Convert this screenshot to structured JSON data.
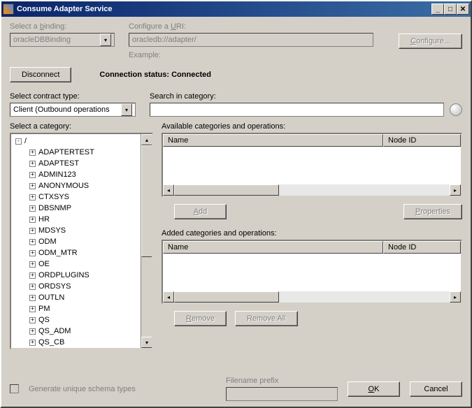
{
  "titlebar": {
    "title": "Consume Adapter Service"
  },
  "section1": {
    "binding_label": "Select a binding:",
    "binding_value": "oracleDBBinding",
    "uri_label": "Configure a URI:",
    "uri_value": "oracledb://adapter/",
    "example_label": "Example:",
    "configure_btn": "Configure..."
  },
  "status": {
    "disconnect_btn": "Disconnect",
    "status_label": "Connection status:",
    "status_value": "Connected"
  },
  "contract": {
    "label": "Select contract type:",
    "value": "Client (Outbound operations",
    "search_label": "Search in category:",
    "search_value": ""
  },
  "tree": {
    "label": "Select a category:",
    "root": "/",
    "items": [
      "ADAPTERTEST",
      "ADAPTEST",
      "ADMIN123",
      "ANONYMOUS",
      "CTXSYS",
      "DBSNMP",
      "HR",
      "MDSYS",
      "ODM",
      "ODM_MTR",
      "OE",
      "ORDPLUGINS",
      "ORDSYS",
      "OUTLN",
      "PM",
      "QS",
      "QS_ADM",
      "QS_CB"
    ]
  },
  "available": {
    "label": "Available categories and operations:",
    "col_name": "Name",
    "col_nodeid": "Node ID",
    "add_btn": "Add",
    "properties_btn": "Properties"
  },
  "added": {
    "label": "Added categories and operations:",
    "col_name": "Name",
    "col_nodeid": "Node ID",
    "remove_btn": "Remove",
    "removeall_btn": "Remove All"
  },
  "bottom": {
    "schema_checkbox": "Generate unique schema types",
    "filename_label": "Filename prefix",
    "filename_value": "",
    "ok_btn": "OK",
    "cancel_btn": "Cancel"
  }
}
